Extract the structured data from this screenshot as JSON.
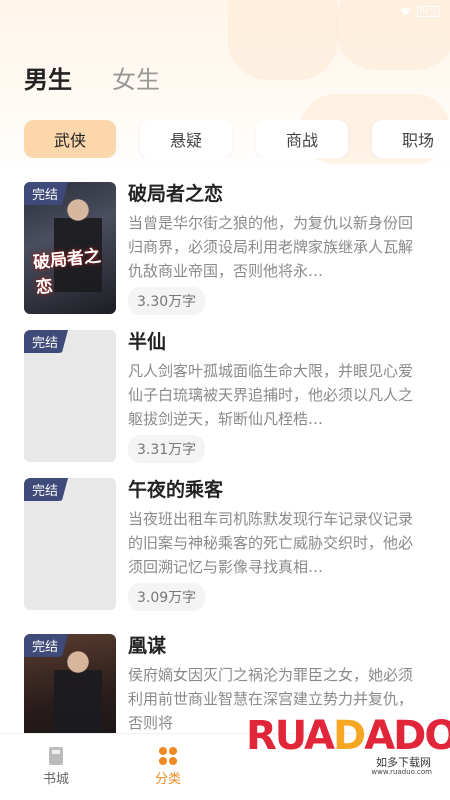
{
  "status": {
    "battery": "9x%"
  },
  "gender_tabs": [
    {
      "label": "男生",
      "active": true
    },
    {
      "label": "女生",
      "active": false
    }
  ],
  "category_chips": [
    {
      "label": "武侠",
      "active": true
    },
    {
      "label": "悬疑",
      "active": false
    },
    {
      "label": "商战",
      "active": false
    },
    {
      "label": "职场",
      "active": false
    }
  ],
  "books": [
    {
      "badge": "完结",
      "cover_title": "破局者之恋",
      "title": "破局者之恋",
      "desc": "当曾是华尔街之狼的他，为复仇以新身份回归商界，必须设局利用老牌家族继承人瓦解仇敌商业帝国，否则他将永…",
      "words": "3.30万字"
    },
    {
      "badge": "完结",
      "title": "半仙",
      "desc": "凡人剑客叶孤城面临生命大限，并眼见心爱仙子白琉璃被天界追捕时，他必须以凡人之躯拔剑逆天，斩断仙凡桎梏…",
      "words": "3.31万字"
    },
    {
      "badge": "完结",
      "title": "午夜的乘客",
      "desc": "当夜班出租车司机陈默发现行车记录仪记录的旧案与神秘乘客的死亡威胁交织时，他必须回溯记忆与影像寻找真相…",
      "words": "3.09万字"
    },
    {
      "badge": "完结",
      "title": "凰谋",
      "desc": "侯府嫡女因灭门之祸沦为罪臣之女，她必须利用前世商业智慧在深宫建立势力并复仇，否则将",
      "words": ""
    }
  ],
  "bottom_nav": [
    {
      "label": "书城",
      "icon": "book-icon",
      "active": false
    },
    {
      "label": "分类",
      "icon": "category-icon",
      "active": true
    }
  ],
  "watermark": {
    "brand": "RUANDAO",
    "sub": "如多下载网",
    "url": "www.ruaduo.com"
  },
  "colors": {
    "accent": "#f08a24",
    "chip_active": "#fbd7ab",
    "badge": "#3e4a7a"
  }
}
